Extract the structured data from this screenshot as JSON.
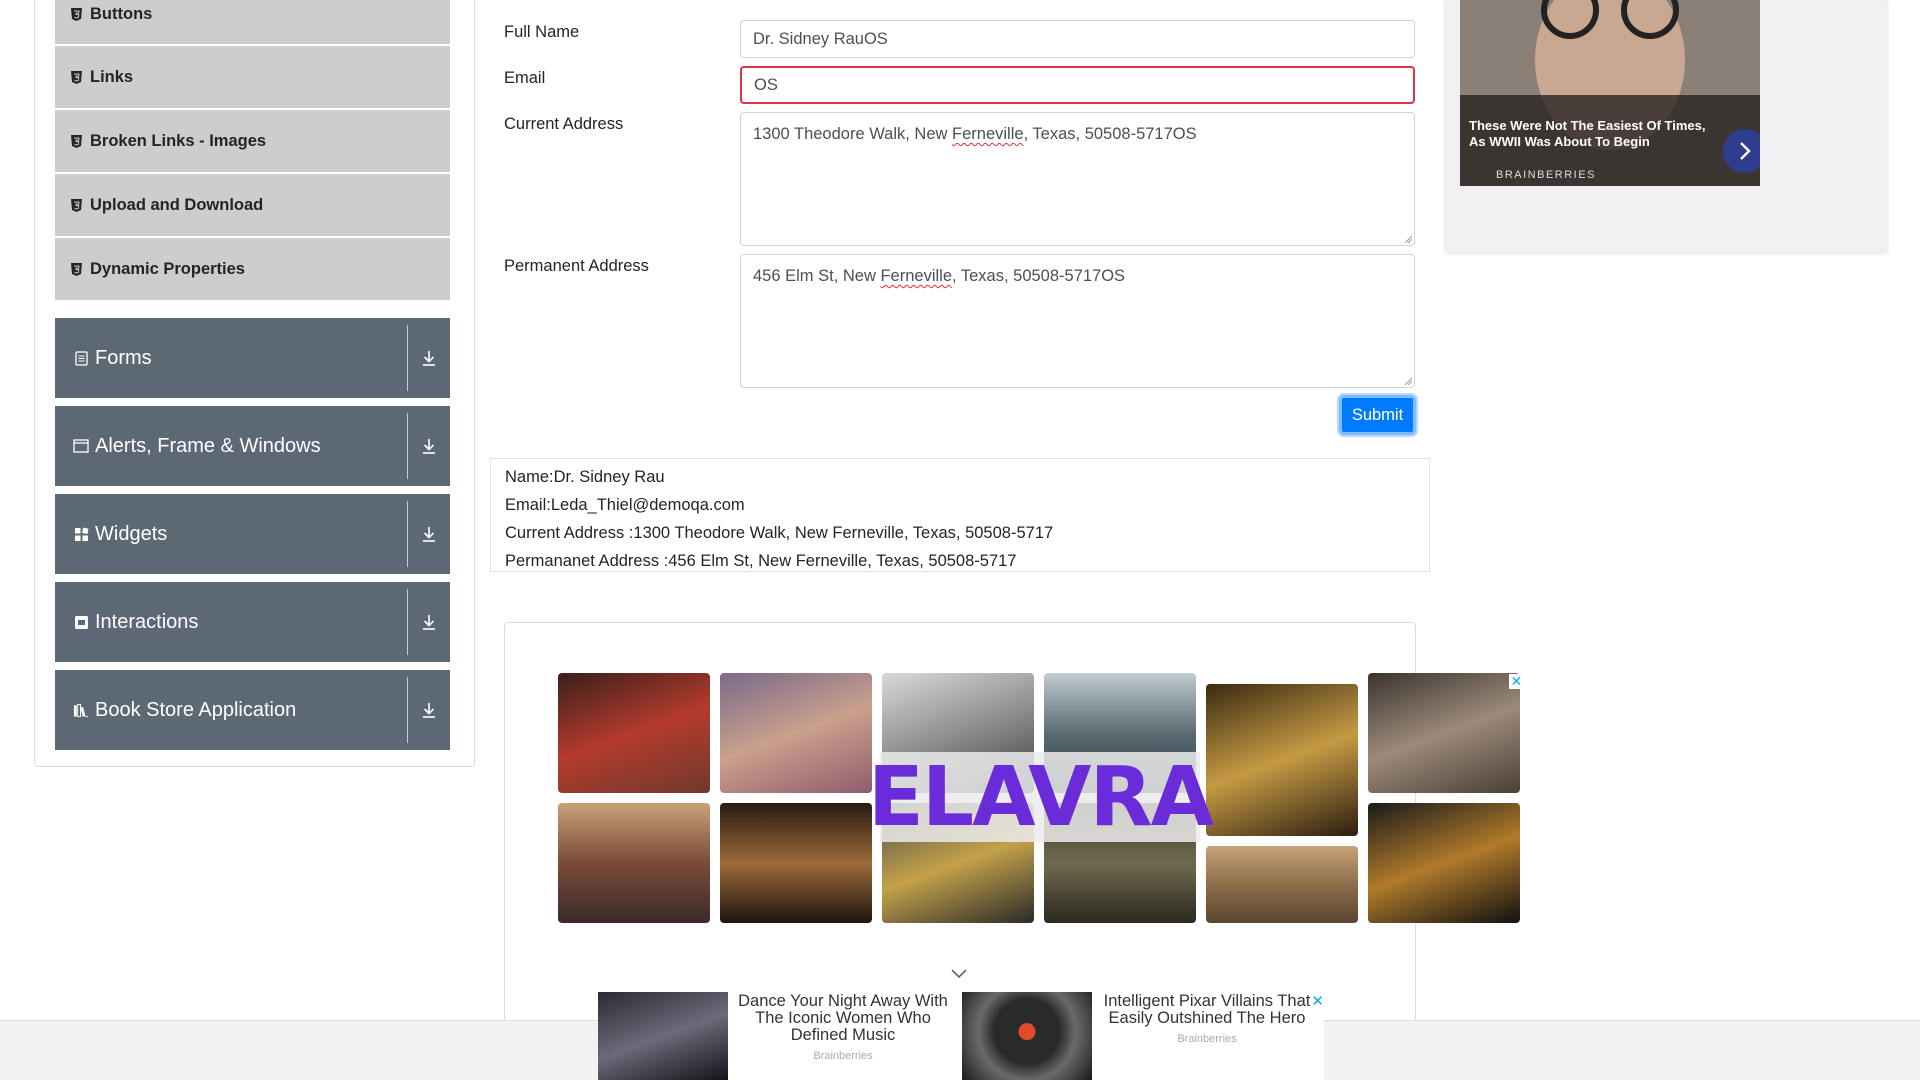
{
  "sidebar": {
    "sub_items": [
      {
        "label": "Buttons"
      },
      {
        "label": "Links"
      },
      {
        "label": "Broken Links - Images"
      },
      {
        "label": "Upload and Download"
      },
      {
        "label": "Dynamic Properties"
      }
    ],
    "groups": [
      {
        "label": "Forms",
        "icon": "form-icon"
      },
      {
        "label": "Alerts, Frame & Windows",
        "icon": "window-icon"
      },
      {
        "label": "Widgets",
        "icon": "widgets-icon"
      },
      {
        "label": "Interactions",
        "icon": "interactions-icon"
      },
      {
        "label": "Book Store Application",
        "icon": "books-icon"
      }
    ]
  },
  "form": {
    "full_name_label": "Full Name",
    "full_name_value": "Dr. Sidney RauOS",
    "email_label": "Email",
    "email_value": "OS",
    "current_address_label": "Current Address",
    "current_address_pre": "1300 Theodore Walk, New ",
    "current_address_misspelled": "Ferneville",
    "current_address_post": ", Texas, 50508-5717OS",
    "permanent_address_label": "Permanent Address",
    "permanent_address_pre": "456 Elm St, New ",
    "permanent_address_misspelled": "Ferneville",
    "permanent_address_post": ", Texas, 50508-5717OS",
    "submit_label": "Submit"
  },
  "output": {
    "name": "Name:Dr. Sidney Rau",
    "email": "Email:Leda_Thiel@demoqa.com",
    "current_address": "Current Address :1300 Theodore Walk, New Ferneville, Texas, 50508-5717",
    "permanent_address": "Permananet Address :456 Elm St, New Ferneville, Texas, 50508-5717"
  },
  "ads": {
    "top_right": {
      "headline": "These Were Not The Easiest Of Times, As WWII Was About To Begin",
      "brand": "BRAINBERRIES"
    },
    "center": {
      "logo_text": "ELAVRA",
      "close": "✕"
    },
    "bottom": [
      {
        "title": "Dance Your Night Away With The Iconic Women Who Defined Music",
        "source": "Brainberries"
      },
      {
        "title": "Intelligent Pixar Villains That Easily Outshined The Hero",
        "source": "Brainberries"
      }
    ],
    "bottom_close": "✕"
  },
  "colors": {
    "primary": "#007bff",
    "error": "#dc3545",
    "sidebar_group": "#5d6875",
    "sidebar_sub": "#cdcdcd",
    "ad_logo": "#6a2bd9"
  }
}
